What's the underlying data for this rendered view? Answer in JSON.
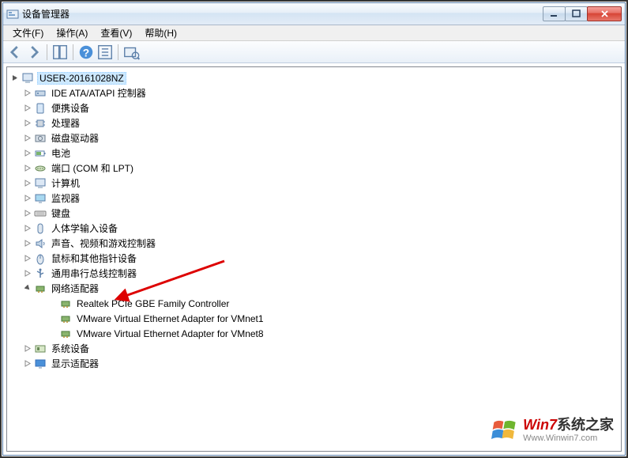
{
  "window": {
    "title": "设备管理器"
  },
  "menu": {
    "file": "文件(F)",
    "action": "操作(A)",
    "view": "查看(V)",
    "help": "帮助(H)"
  },
  "tree": {
    "root": "USER-20161028NZ",
    "items": [
      "IDE ATA/ATAPI 控制器",
      "便携设备",
      "处理器",
      "磁盘驱动器",
      "电池",
      "端口 (COM 和 LPT)",
      "计算机",
      "监视器",
      "键盘",
      "人体学输入设备",
      "声音、视频和游戏控制器",
      "鼠标和其他指针设备",
      "通用串行总线控制器"
    ],
    "network": {
      "label": "网络适配器",
      "children": [
        "Realtek PCIe GBE Family Controller",
        "VMware Virtual Ethernet Adapter for VMnet1",
        "VMware Virtual Ethernet Adapter for VMnet8"
      ]
    },
    "after": [
      "系统设备",
      "显示适配器"
    ]
  },
  "watermark": {
    "brand_prefix": "Win7",
    "brand_suffix": "系统之家",
    "url": "Www.Winwin7.com"
  }
}
